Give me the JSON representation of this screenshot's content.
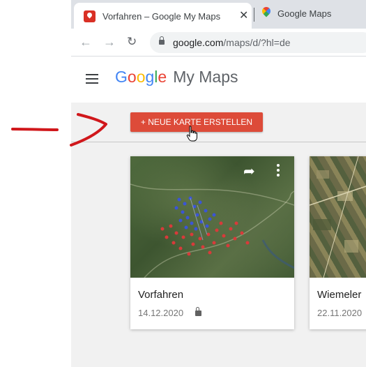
{
  "browser": {
    "tabs": [
      {
        "title": "Vorfahren – Google My Maps",
        "active": true,
        "icon": "mymaps-pin-icon"
      },
      {
        "title": "Google Maps",
        "active": false,
        "icon": "google-maps-pin-icon"
      }
    ],
    "tab_close_glyph": "✕",
    "url_host": "google.com",
    "url_path": "/maps/d/?hl=de"
  },
  "app": {
    "logo_letters": [
      "G",
      "o",
      "o",
      "g",
      "l",
      "e"
    ],
    "product_name": "My Maps"
  },
  "toolbar": {
    "new_map_label": "+ NEUE KARTE ERSTELLEN"
  },
  "maps": [
    {
      "title": "Vorfahren",
      "date": "14.12.2020",
      "private": true
    },
    {
      "title": "Wiemeler",
      "date": "22.11.2020",
      "private": false
    }
  ],
  "colors": {
    "accent_button": "#dd4b39",
    "annotation": "#d0171b"
  }
}
